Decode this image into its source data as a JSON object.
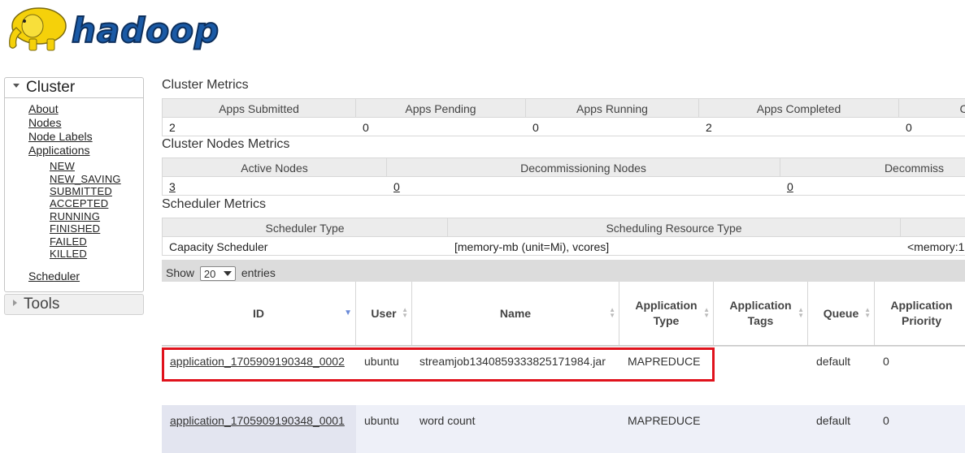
{
  "logo": {
    "text": "hadoop"
  },
  "sidebar": {
    "cluster_label": "Cluster",
    "tools_label": "Tools",
    "links": {
      "about": "About",
      "nodes": "Nodes",
      "node_labels": "Node Labels",
      "applications": "Applications",
      "scheduler": "Scheduler"
    },
    "app_states": [
      "NEW",
      "NEW_SAVING",
      "SUBMITTED",
      "ACCEPTED",
      "RUNNING",
      "FINISHED",
      "FAILED",
      "KILLED"
    ]
  },
  "cluster_metrics": {
    "title": "Cluster Metrics",
    "headers": [
      "Apps Submitted",
      "Apps Pending",
      "Apps Running",
      "Apps Completed",
      "C"
    ],
    "values": [
      "2",
      "0",
      "0",
      "2",
      "0"
    ]
  },
  "nodes_metrics": {
    "title": "Cluster Nodes Metrics",
    "headers": [
      "Active Nodes",
      "Decommissioning Nodes",
      "Decommiss"
    ],
    "values": [
      "3",
      "0",
      "0"
    ]
  },
  "scheduler_metrics": {
    "title": "Scheduler Metrics",
    "headers": [
      "Scheduler Type",
      "Scheduling Resource Type",
      ""
    ],
    "values": [
      "Capacity Scheduler",
      "[memory-mb (unit=Mi), vcores]",
      "<memory:1"
    ]
  },
  "apps_table": {
    "show_label": "Show",
    "entries_value": "20",
    "entries_label": "entries",
    "columns": {
      "id": "ID",
      "user": "User",
      "name": "Name",
      "app_type_1": "Application",
      "app_type_2": "Type",
      "app_tags_1": "Application",
      "app_tags_2": "Tags",
      "queue": "Queue",
      "priority_1": "Application",
      "priority_2": "Priority"
    },
    "rows": [
      {
        "id": "application_1705909190348_0002",
        "user": "ubuntu",
        "name": "streamjob1340859333825171984.jar",
        "type": "MAPREDUCE",
        "tags": "",
        "queue": "default",
        "priority": "0"
      },
      {
        "id": "application_1705909190348_0001",
        "user": "ubuntu",
        "name": "word count",
        "type": "MAPREDUCE",
        "tags": "",
        "queue": "default",
        "priority": "0"
      }
    ]
  },
  "colors": {
    "highlight": "#e0121c",
    "logo_blue": "#1a5aa6",
    "logo_yellow": "#f5d10a"
  }
}
